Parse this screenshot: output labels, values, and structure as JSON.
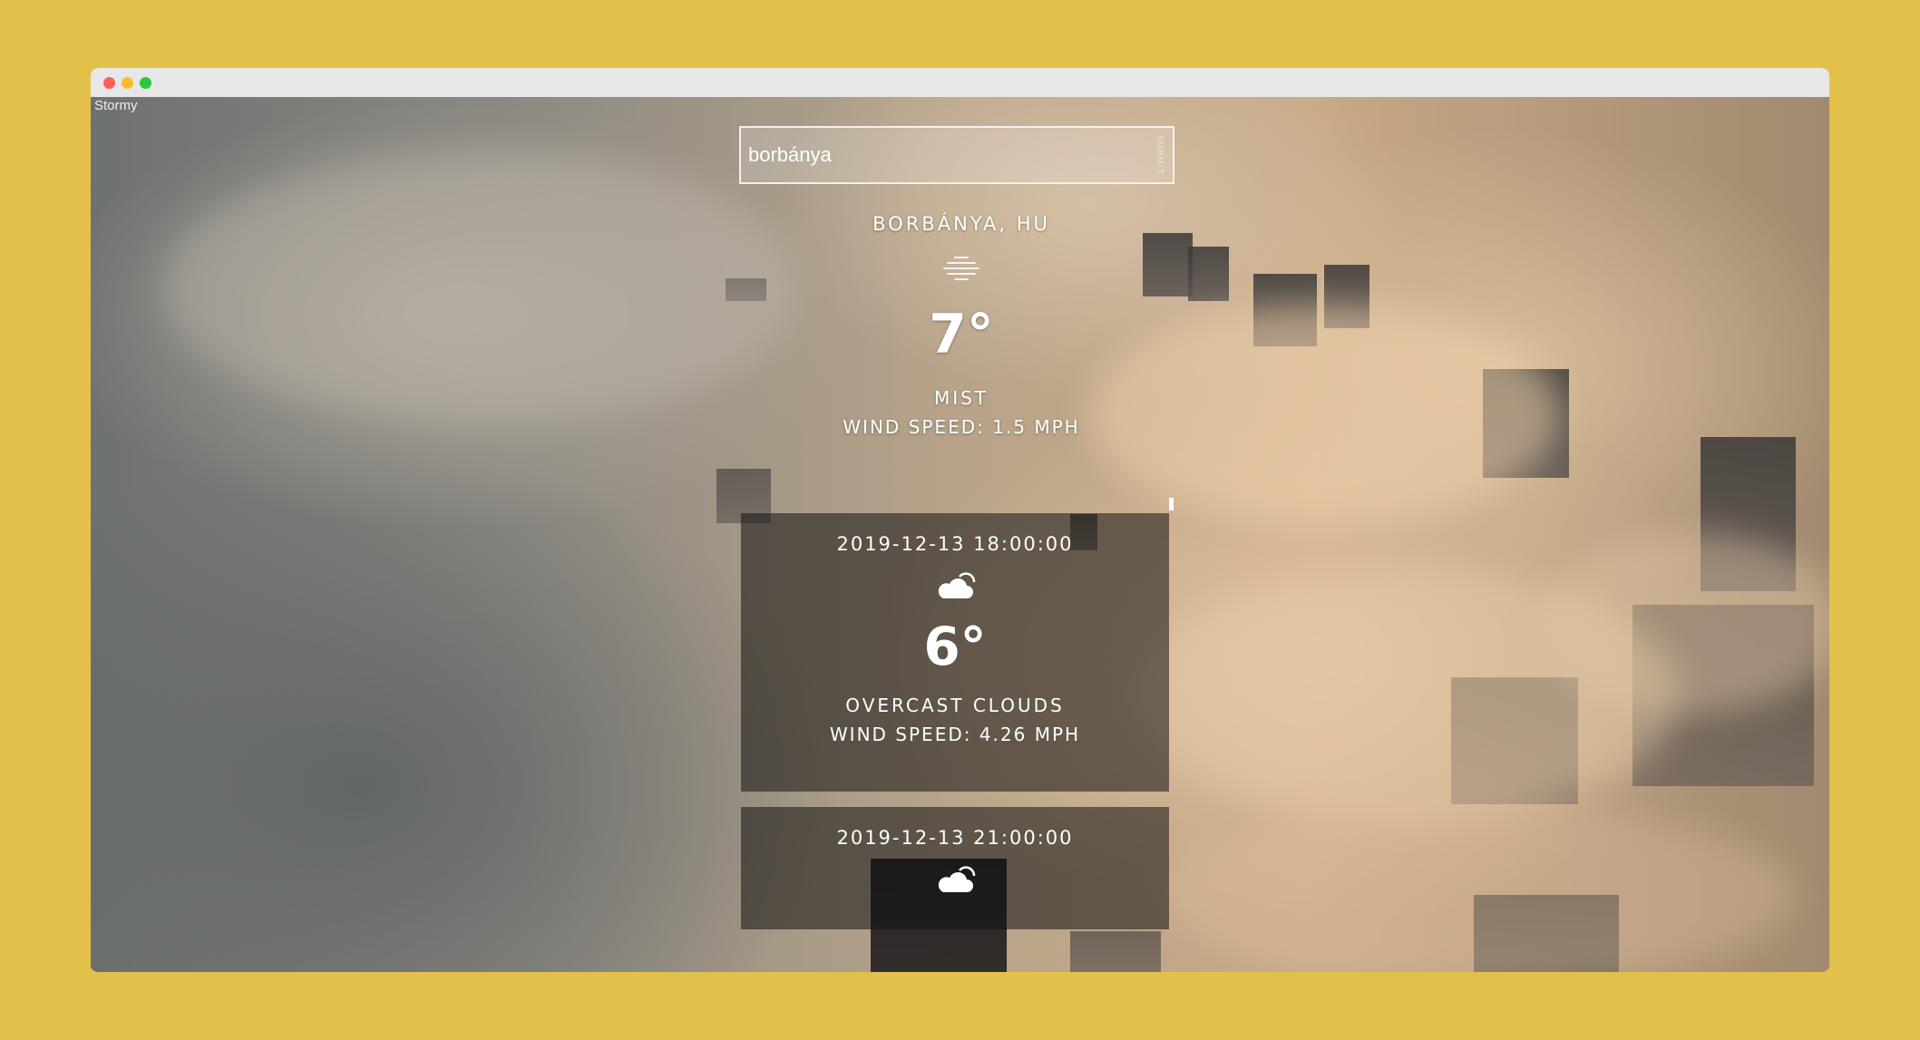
{
  "window": {
    "app_label": "Stormy"
  },
  "search": {
    "value": "borbánya",
    "submit_label": "SUBMIT"
  },
  "current": {
    "location": "BORBÁNYA, HU",
    "icon": "mist-icon",
    "temperature": "7°",
    "condition": "MIST",
    "wind": "WIND SPEED: 1.5 MPH"
  },
  "forecast": [
    {
      "datetime": "2019-12-13 18:00:00",
      "icon": "cloud-icon",
      "temperature": "6°",
      "condition": "OVERCAST CLOUDS",
      "wind": "WIND SPEED: 4.26 MPH"
    },
    {
      "datetime": "2019-12-13 21:00:00",
      "icon": "cloud-icon"
    }
  ],
  "colors": {
    "background": "#e2c04a",
    "titlebar": "#e7e7e7",
    "card": "rgba(20,18,17,0.55)",
    "text": "#ffffff"
  }
}
